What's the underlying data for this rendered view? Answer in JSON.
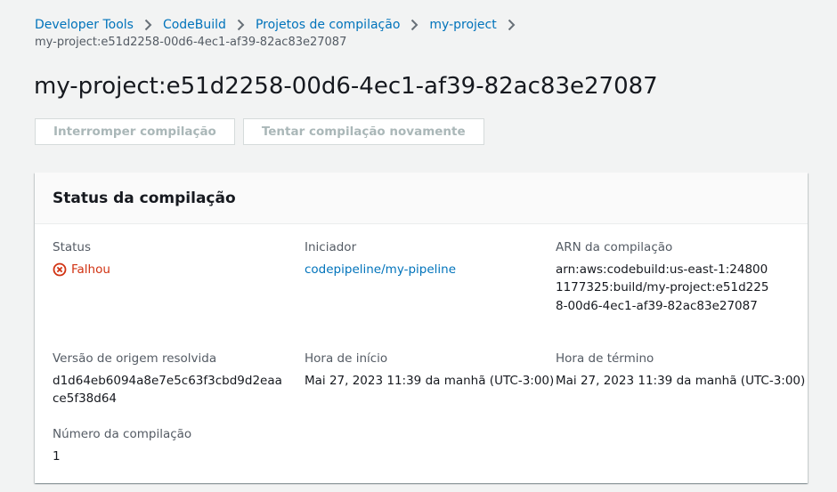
{
  "breadcrumb": {
    "items": [
      "Developer Tools",
      "CodeBuild",
      "Projetos de compilação",
      "my-project"
    ],
    "current": "my-project:e51d2258-00d6-4ec1-af39-82ac83e27087"
  },
  "page": {
    "title": "my-project:e51d2258-00d6-4ec1-af39-82ac83e27087"
  },
  "actions": {
    "stop_label": "Interromper compilação",
    "retry_label": "Tentar compilação novamente"
  },
  "build_status": {
    "title": "Status da compilação",
    "status_label": "Status",
    "status_value": "Falhou",
    "initiator_label": "Iniciador",
    "initiator_value": "codepipeline/my-pipeline",
    "arn_label": "ARN da compilação",
    "arn_value": "arn:aws:codebuild:us-east-1:248001177325:build/my-project:e51d2258-00d6-4ec1-af39-82ac83e27087",
    "source_label": "Versão de origem resolvida",
    "source_value": "d1d64eb6094a8e7e5c63f3cbd9d2eaace5f38d64",
    "start_label": "Hora de início",
    "start_value": "Mai 27, 2023 11:39 da manhã (UTC-3:00)",
    "end_label": "Hora de término",
    "end_value": "Mai 27, 2023 11:39 da manhã (UTC-3:00)",
    "number_label": "Número da compilação",
    "number_value": "1"
  },
  "colors": {
    "link": "#0073bb",
    "error": "#d13212",
    "background": "#f2f3f3"
  }
}
